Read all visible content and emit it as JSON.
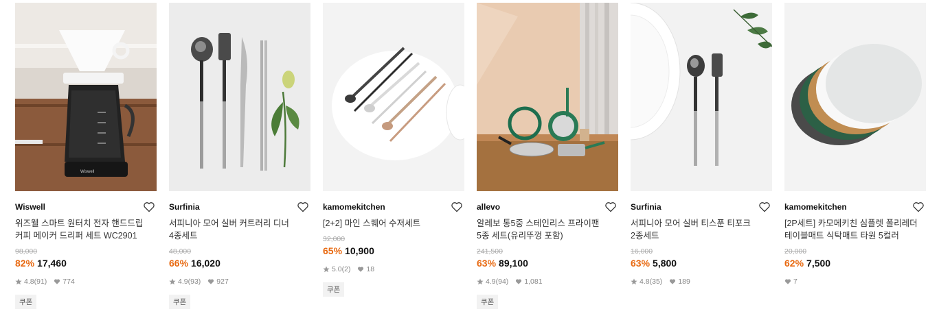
{
  "products": [
    {
      "brand": "Wiswell",
      "title_line1": "위즈웰 스마트 원터치 전자 핸드드립",
      "title_line2": "커피 메이커 드리퍼 세트 WC2901",
      "original_price": "98,000",
      "discount": "82%",
      "price": "17,460",
      "rating": "4.8",
      "review_count": "(91)",
      "likes": "774",
      "coupon": "쿠폰",
      "image_text": "Wiswell"
    },
    {
      "brand": "Surfinia",
      "title_line1": "서피니아 모어 실버 커트러리 디너",
      "title_line2": "4종세트",
      "original_price": "48,000",
      "discount": "66%",
      "price": "16,020",
      "rating": "4.9",
      "review_count": "(93)",
      "likes": "927",
      "coupon": "쿠폰"
    },
    {
      "brand": "kamomekitchen",
      "title_line1": "[2+2] 마인 스퀘어 수저세트",
      "title_line2": "",
      "original_price": "32,000",
      "discount": "65%",
      "price": "10,900",
      "rating": "5.0",
      "review_count": "(2)",
      "likes": "18",
      "coupon": "쿠폰"
    },
    {
      "brand": "allevo",
      "title_line1": "알레보 통5중 스테인리스 프라이팬",
      "title_line2": "5종 세트(유리뚜껑 포함)",
      "original_price": "241,500",
      "discount": "63%",
      "price": "89,100",
      "rating": "4.9",
      "review_count": "(94)",
      "likes": "1,081",
      "coupon": "쿠폰"
    },
    {
      "brand": "Surfinia",
      "title_line1": "서피니아 모어 실버 티스푼 티포크",
      "title_line2": "2종세트",
      "original_price": "16,000",
      "discount": "63%",
      "price": "5,800",
      "rating": "4.8",
      "review_count": "(35)",
      "likes": "189",
      "coupon": ""
    },
    {
      "brand": "kamomekitchen",
      "title_line1": "[2P세트] 카모메키친 심플렛 폴리레더",
      "title_line2": "테이블매트 식탁매트 타원 5컬러",
      "original_price": "20,000",
      "discount": "62%",
      "price": "7,500",
      "rating": "",
      "review_count": "",
      "likes": "7",
      "coupon": ""
    }
  ],
  "icons": {
    "wishlist": "heart-outline-icon",
    "rating": "star-icon",
    "likes": "heart-filled-icon"
  },
  "colors": {
    "discount": "#e86a12",
    "meta": "#888888"
  }
}
